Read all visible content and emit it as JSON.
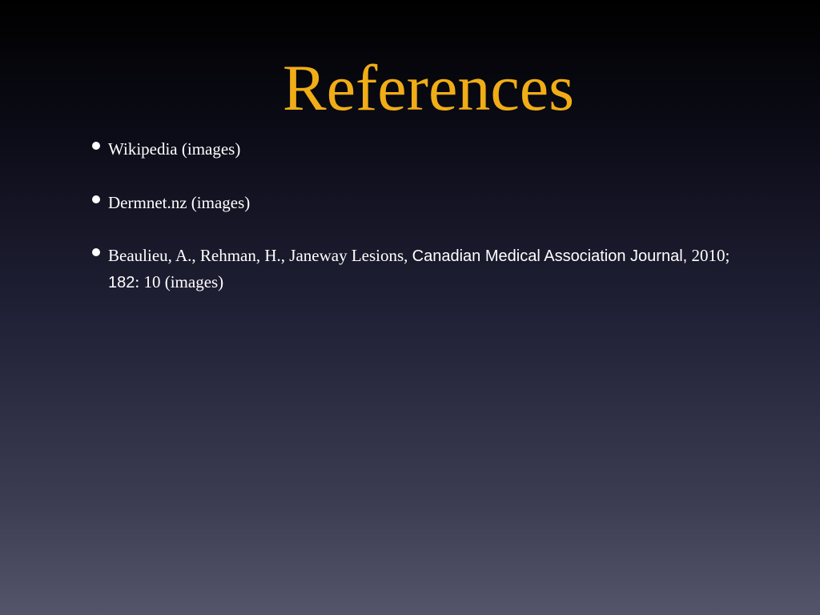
{
  "slide": {
    "title": "References",
    "items": [
      {
        "text": "Wikipedia (images)"
      },
      {
        "text": "Dermnet.nz (images)"
      },
      {
        "authors": "Beaulieu, A., Rehman, H., Janeway Lesions,",
        "journal": "Canadian Medical Association Journal,",
        "year": "2010;",
        "volume": "182",
        "rest": ": 10 (images)"
      }
    ]
  },
  "colors": {
    "title": "#f0ad16",
    "text": "#ffffff",
    "background_top": "#000000",
    "background_bottom": "#54546a"
  }
}
